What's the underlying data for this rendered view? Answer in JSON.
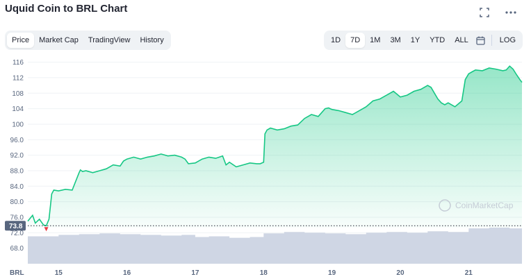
{
  "header": {
    "title": "Uquid Coin to BRL Chart"
  },
  "icons": {
    "fullscreen": "fullscreen-icon",
    "more": "more-icon",
    "calendar": "calendar-icon"
  },
  "tabs": [
    {
      "label": "Price",
      "active": true
    },
    {
      "label": "Market Cap",
      "active": false
    },
    {
      "label": "TradingView",
      "active": false
    },
    {
      "label": "History",
      "active": false
    }
  ],
  "ranges": [
    {
      "label": "1D",
      "active": false
    },
    {
      "label": "7D",
      "active": true
    },
    {
      "label": "1M",
      "active": false
    },
    {
      "label": "3M",
      "active": false
    },
    {
      "label": "1Y",
      "active": false
    },
    {
      "label": "YTD",
      "active": false
    },
    {
      "label": "ALL",
      "active": false
    }
  ],
  "log_label": "LOG",
  "colors": {
    "line": "#16c784",
    "down": "#ea3943",
    "volume": "#cfd6e4",
    "badge": "#58667e"
  },
  "chart_data": {
    "type": "area",
    "currency_label": "BRL",
    "watermark": "CoinMarketCap",
    "current_price_label": "73.8",
    "ylim": [
      64,
      117
    ],
    "y_ticks": [
      "116",
      "112",
      "108",
      "104",
      "100",
      "96.0",
      "92.0",
      "88.0",
      "84.0",
      "80.0",
      "76.0",
      "72.0",
      "68.0"
    ],
    "y_tick_values": [
      116,
      112,
      108,
      104,
      100,
      96,
      92,
      88,
      84,
      80,
      76,
      72,
      68
    ],
    "x_ticks": [
      "15",
      "16",
      "17",
      "18",
      "19",
      "20",
      "21"
    ],
    "x_tick_values": [
      15,
      16,
      17,
      18,
      19,
      20,
      21
    ],
    "xlim": [
      14.55,
      21.78
    ],
    "price": {
      "x": [
        14.55,
        14.62,
        14.66,
        14.72,
        14.78,
        14.82,
        14.86,
        14.9,
        14.93,
        15.0,
        15.1,
        15.2,
        15.3,
        15.32,
        15.35,
        15.4,
        15.5,
        15.6,
        15.7,
        15.8,
        15.9,
        15.95,
        16.0,
        16.1,
        16.2,
        16.3,
        16.4,
        16.5,
        16.6,
        16.7,
        16.8,
        16.85,
        16.9,
        17.0,
        17.1,
        17.2,
        17.3,
        17.4,
        17.45,
        17.5,
        17.6,
        17.7,
        17.8,
        17.9,
        17.95,
        18.0,
        18.02,
        18.05,
        18.1,
        18.2,
        18.3,
        18.4,
        18.5,
        18.6,
        18.7,
        18.8,
        18.9,
        18.95,
        19.0,
        19.1,
        19.2,
        19.3,
        19.4,
        19.5,
        19.6,
        19.7,
        19.75,
        19.8,
        19.9,
        20.0,
        20.1,
        20.2,
        20.3,
        20.4,
        20.45,
        20.5,
        20.55,
        20.6,
        20.65,
        20.7,
        20.8,
        20.9,
        20.95,
        21.0,
        21.05,
        21.1,
        21.2,
        21.3,
        21.4,
        21.5,
        21.55,
        21.6,
        21.65,
        21.7,
        21.75,
        21.78
      ],
      "y": [
        75.0,
        76.5,
        74.5,
        75.5,
        74.0,
        73.8,
        75.5,
        82.0,
        83.0,
        82.8,
        83.2,
        83.0,
        87.5,
        88.2,
        87.8,
        88.0,
        87.5,
        88.0,
        88.5,
        89.5,
        89.2,
        90.5,
        91.0,
        91.5,
        91.0,
        91.5,
        91.8,
        92.3,
        91.8,
        92.0,
        91.5,
        91.0,
        89.8,
        90.0,
        91.0,
        91.5,
        91.2,
        91.8,
        89.5,
        90.2,
        89.0,
        89.5,
        90.0,
        89.8,
        89.8,
        90.2,
        97.5,
        98.5,
        99.0,
        98.5,
        98.8,
        99.5,
        99.8,
        101.5,
        102.5,
        102.0,
        104.0,
        104.2,
        103.8,
        103.5,
        103.0,
        102.5,
        103.5,
        104.5,
        106.0,
        106.5,
        107.0,
        107.5,
        108.5,
        107.0,
        107.5,
        108.5,
        109.0,
        110.0,
        109.5,
        108.0,
        106.5,
        105.5,
        105.0,
        105.5,
        104.5,
        106.0,
        111.5,
        113.0,
        113.5,
        114.0,
        113.8,
        114.5,
        114.2,
        113.8,
        114.0,
        115.0,
        114.2,
        112.8,
        111.5,
        110.8
      ]
    },
    "volume_note": "relative volume shading",
    "volume": {
      "x": [
        14.55,
        15.0,
        15.3,
        15.6,
        15.9,
        16.2,
        16.5,
        16.8,
        17.0,
        17.2,
        17.5,
        17.8,
        18.0,
        18.3,
        18.6,
        18.9,
        19.2,
        19.5,
        19.8,
        20.1,
        20.4,
        20.7,
        21.0,
        21.3,
        21.6,
        21.78
      ],
      "y": [
        0.76,
        0.8,
        0.82,
        0.84,
        0.82,
        0.8,
        0.78,
        0.8,
        0.74,
        0.76,
        0.72,
        0.74,
        0.84,
        0.88,
        0.86,
        0.84,
        0.82,
        0.86,
        0.88,
        0.86,
        0.9,
        0.88,
        0.98,
        1.0,
        0.98,
        0.96
      ]
    }
  }
}
